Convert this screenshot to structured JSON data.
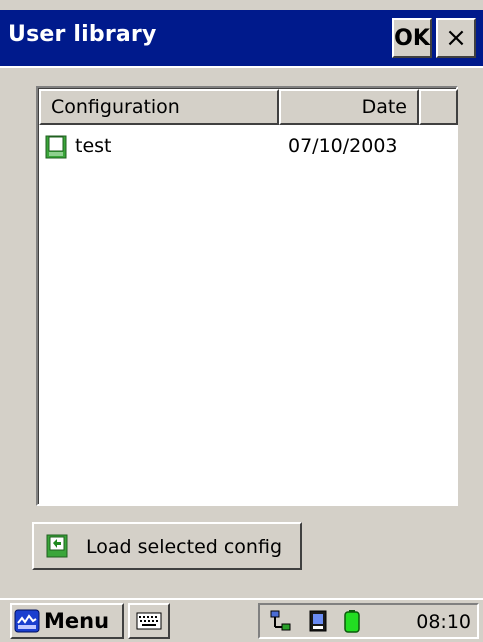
{
  "window": {
    "title": "User library",
    "ok_label": "OK",
    "close_label": "×"
  },
  "list": {
    "columns": [
      "Configuration",
      "Date",
      ""
    ],
    "rows": [
      {
        "name": "test",
        "date": "07/10/2003",
        "icon": "config-file-icon"
      }
    ]
  },
  "actions": {
    "load_label": "Load selected config",
    "load_icon": "load-config-icon"
  },
  "taskbar": {
    "start_label": "Menu",
    "start_icon": "start-menu-icon",
    "keyboard_icon": "keyboard-icon",
    "tray_icons": [
      "network-icon",
      "device-icon",
      "battery-icon"
    ],
    "clock": "08:10"
  },
  "colors": {
    "titlebar": "#001a8c",
    "face": "#d4d0c8",
    "highlight": "#ffffff",
    "shadow": "#404040"
  }
}
